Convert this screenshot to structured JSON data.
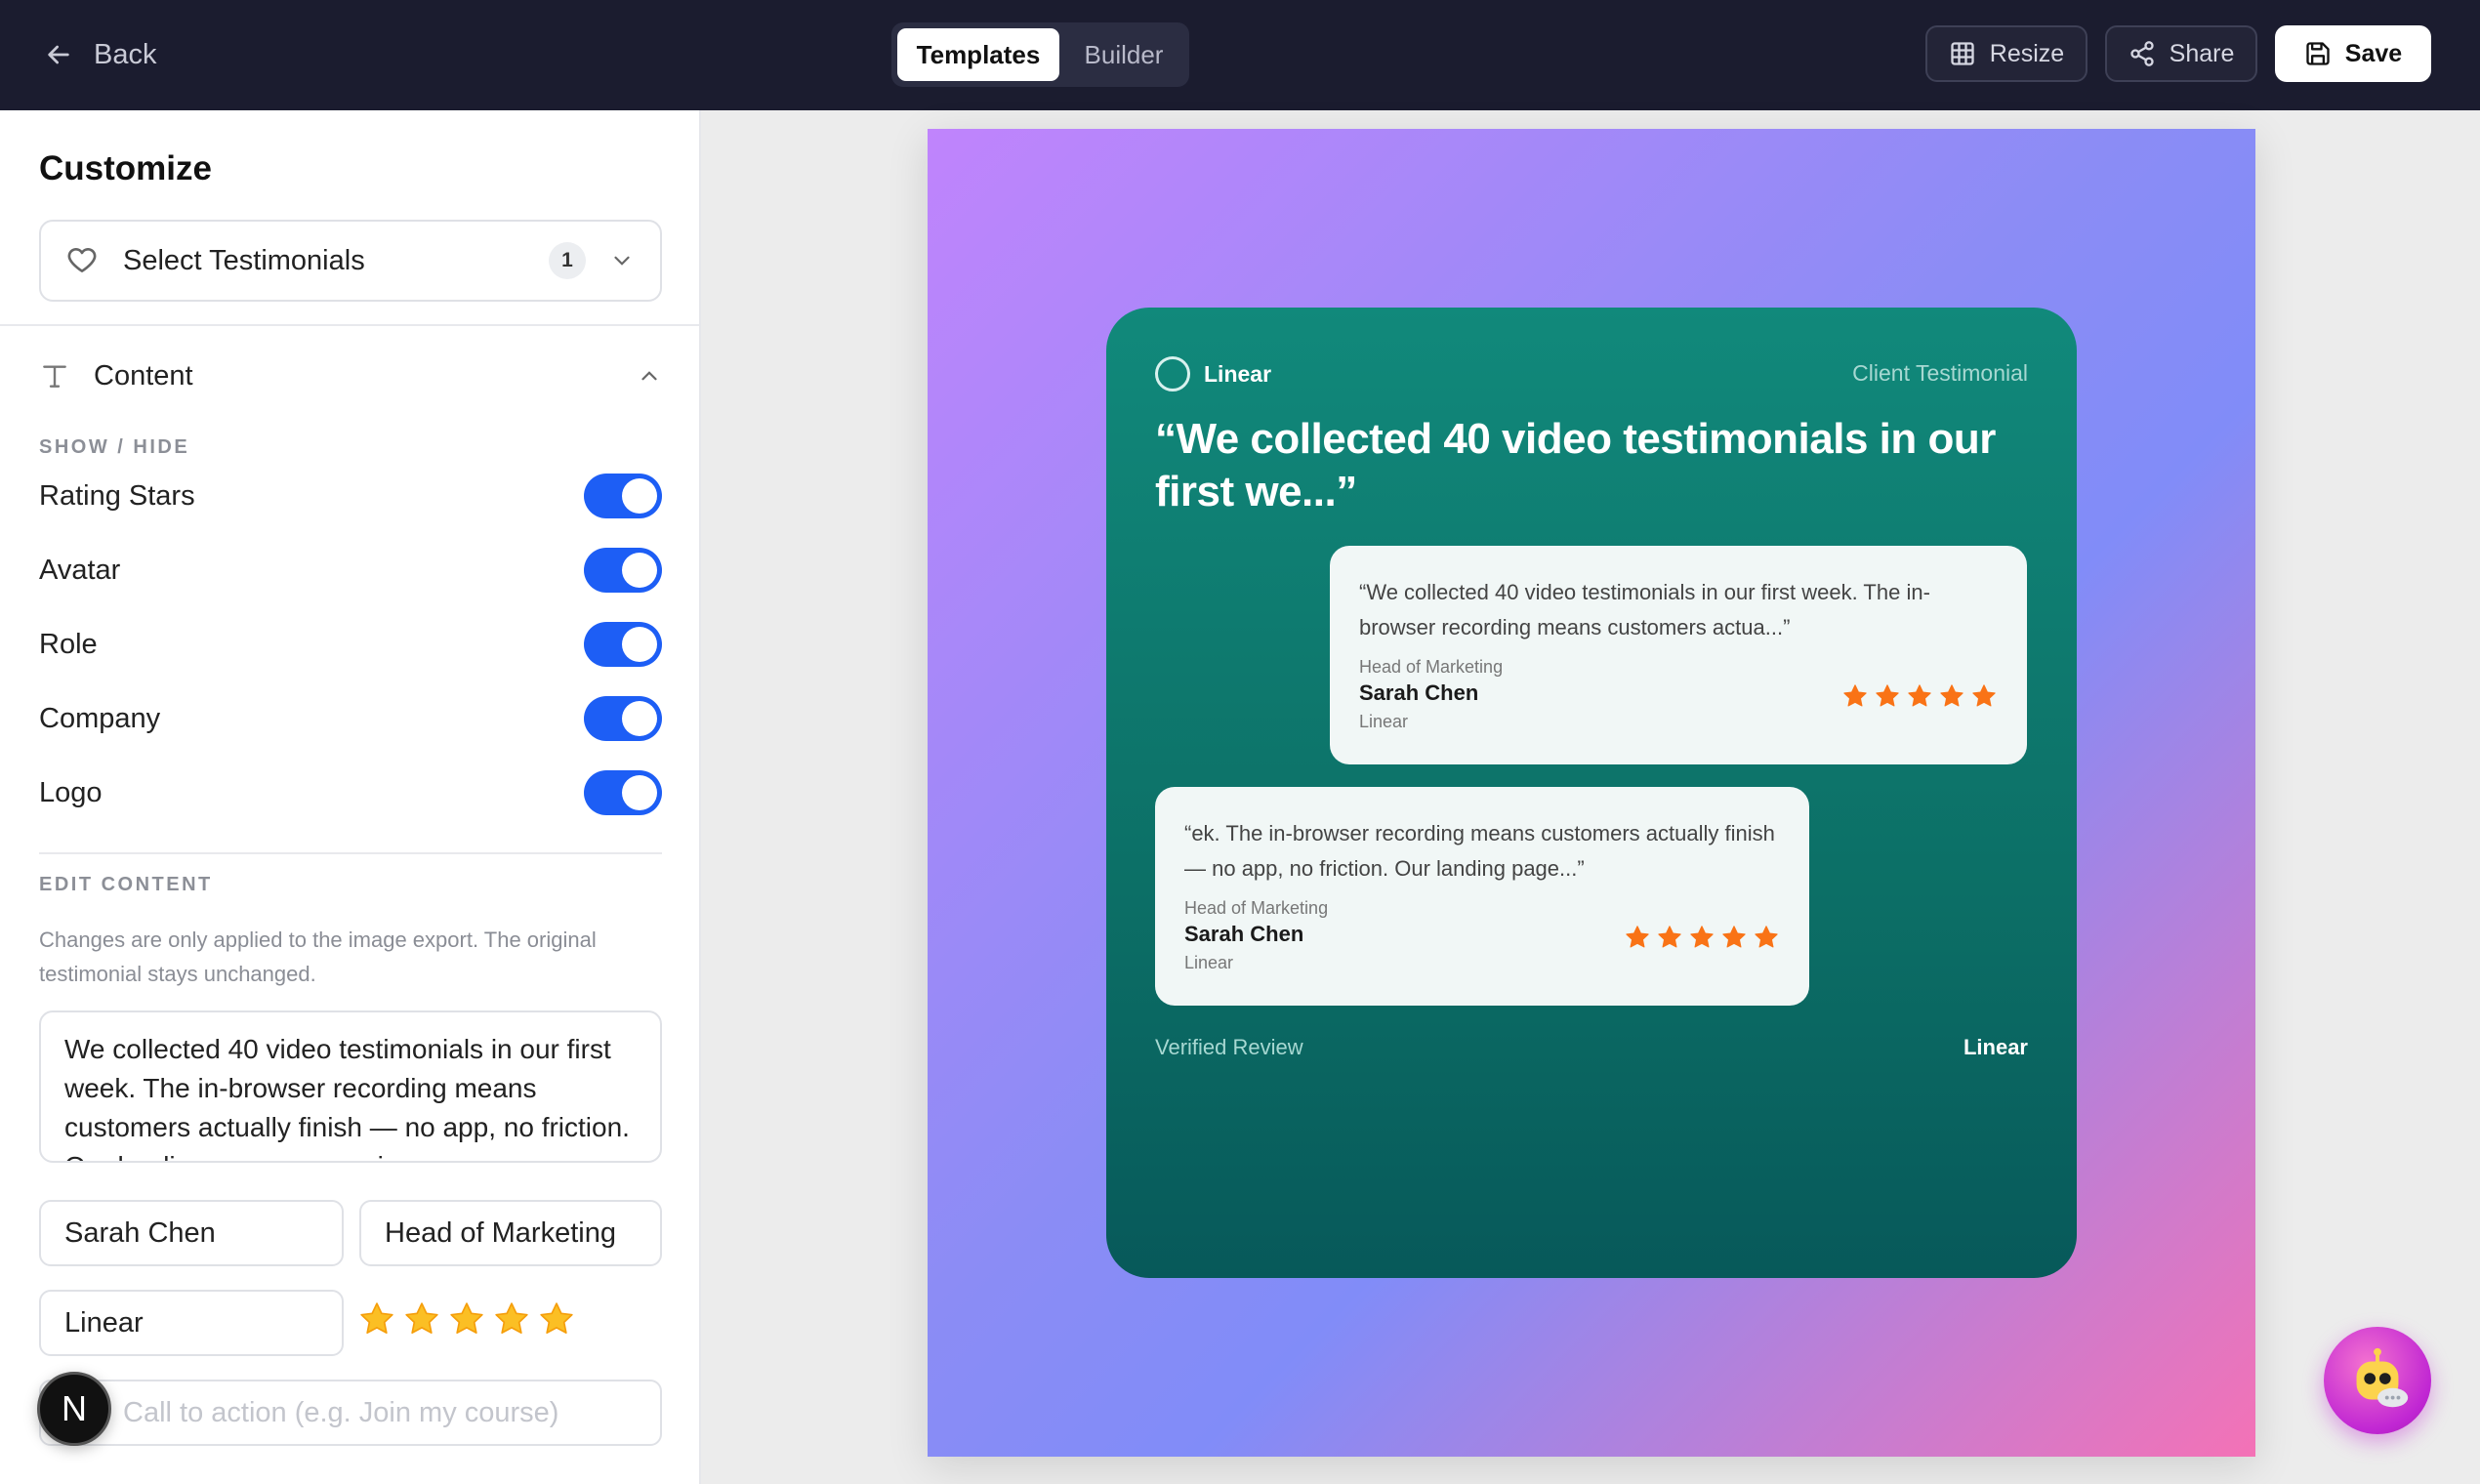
{
  "topbar": {
    "back_label": "Back",
    "tabs": [
      {
        "label": "Templates",
        "active": true
      },
      {
        "label": "Builder",
        "active": false
      }
    ],
    "resize_label": "Resize",
    "share_label": "Share",
    "save_label": "Save"
  },
  "sidebar": {
    "title": "Customize",
    "select": {
      "label": "Select Testimonials",
      "count": "1"
    },
    "content_section": "Content",
    "show_hide_label": "SHOW / HIDE",
    "toggles": [
      {
        "label": "Rating Stars",
        "on": true
      },
      {
        "label": "Avatar",
        "on": true
      },
      {
        "label": "Role",
        "on": true
      },
      {
        "label": "Company",
        "on": true
      },
      {
        "label": "Logo",
        "on": true
      }
    ],
    "edit_content_label": "EDIT CONTENT",
    "help_text": "Changes are only applied to the image export. The original testimonial stays unchanged.",
    "testimonial_text": "We collected 40 video testimonials in our first week. The in-browser recording means customers actually finish — no app, no friction. Our landing page conversion",
    "name_value": "Sarah Chen",
    "role_value": "Head of Marketing",
    "company_value": "Linear",
    "rating": 5,
    "cta_placeholder": "Call to action (e.g. Join my course)",
    "avatar_initial": "N"
  },
  "card": {
    "brand": "Linear",
    "client_label": "Client Testimonial",
    "headline": "“We collected 40 video testimonials in our first we...”",
    "bubbles": [
      {
        "quote": "“We collected 40 video testimonials in our first week. The in-browser recording means customers actua...”",
        "role": "Head of Marketing",
        "name": "Sarah Chen",
        "company": "Linear",
        "rating": 5
      },
      {
        "quote": "“ek. The in-browser recording means customers actually finish — no app, no friction. Our landing page...”",
        "role": "Head of Marketing",
        "name": "Sarah Chen",
        "company": "Linear",
        "rating": 5
      }
    ],
    "verified_label": "Verified Review",
    "footer_brand": "Linear"
  },
  "colors": {
    "topbar_bg": "#1b1c2f",
    "toggle_on": "#1d5ef5",
    "card_teal": "#0c7a6f",
    "star_orange": "#f97316",
    "star_yellow": "#fbbf24"
  },
  "icons": {
    "back": "arrow-left-icon",
    "resize": "grid-icon",
    "share": "share-icon",
    "save": "floppy-disk-icon",
    "select": "heart-icon",
    "content": "text-type-icon",
    "assistant": "robot-chat-icon"
  }
}
